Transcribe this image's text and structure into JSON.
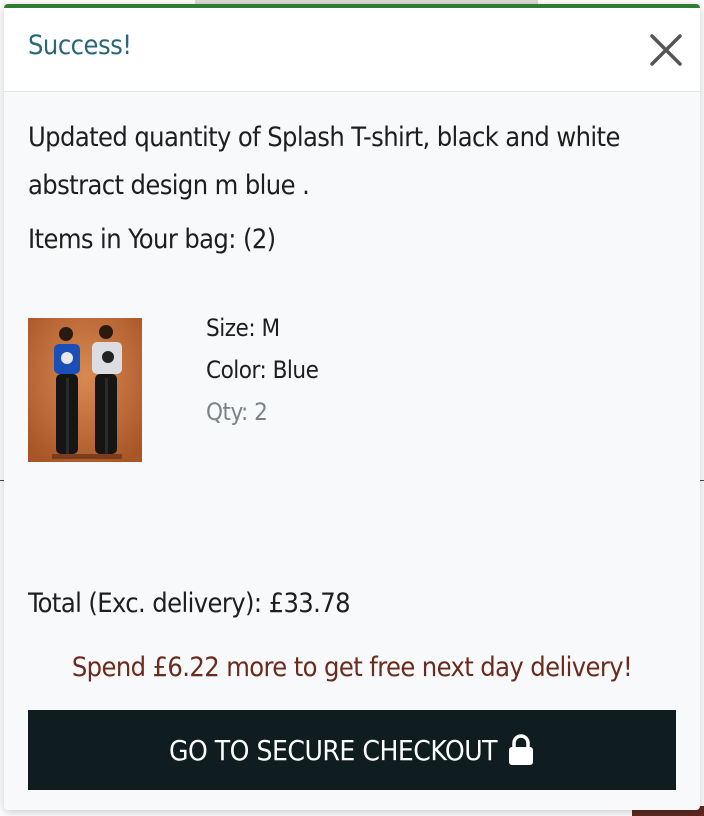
{
  "toast": {
    "title": "Success!",
    "message": "Updated quantity of Splash T-shirt, black and white abstract design m blue .",
    "items_in_bag": "Items in Your bag: (2)",
    "product": {
      "size": "Size: M",
      "color": "Color: Blue",
      "qty": "Qty: 2"
    },
    "total": "Total (Exc. delivery): £33.78",
    "delivery_note": "Spend £6.22 more to get free next day delivery!",
    "checkout_label": "GO TO SECURE CHECKOUT"
  },
  "icons": {
    "close": "close-icon",
    "lock": "lock-icon"
  },
  "colors": {
    "accent": "#2e7d32",
    "title": "#2b6777",
    "delivery_note": "#6b2a1e",
    "button_bg": "#0f1d21"
  }
}
